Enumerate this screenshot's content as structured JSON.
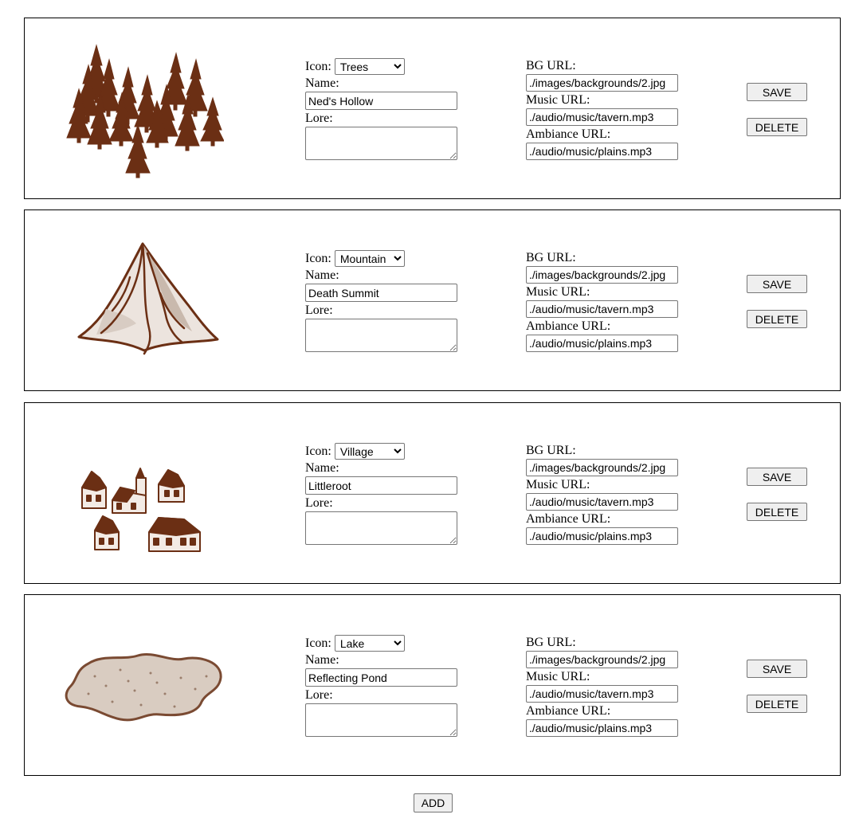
{
  "labels": {
    "icon": "Icon:",
    "name": "Name:",
    "lore": "Lore:",
    "bg_url": "BG URL:",
    "music_url": "Music URL:",
    "ambiance_url": "Ambiance URL:",
    "save": "SAVE",
    "delete": "DELETE",
    "add": "ADD"
  },
  "colors": {
    "ink": "#6b2f14",
    "mountain_shade": "#c9b9ad",
    "lake_fill": "#d9ccc1",
    "lake_border": "#7a4a32"
  },
  "locations": [
    {
      "icon_name": "trees-icon",
      "icon": "Trees",
      "name": "Ned's Hollow",
      "lore": "",
      "bg_url": "./images/backgrounds/2.jpg",
      "music_url": "./audio/music/tavern.mp3",
      "ambiance_url": "./audio/music/plains.mp3"
    },
    {
      "icon_name": "mountain-icon",
      "icon": "Mountain",
      "name": "Death Summit",
      "lore": "",
      "bg_url": "./images/backgrounds/2.jpg",
      "music_url": "./audio/music/tavern.mp3",
      "ambiance_url": "./audio/music/plains.mp3"
    },
    {
      "icon_name": "village-icon",
      "icon": "Village",
      "name": "Littleroot",
      "lore": "",
      "bg_url": "./images/backgrounds/2.jpg",
      "music_url": "./audio/music/tavern.mp3",
      "ambiance_url": "./audio/music/plains.mp3"
    },
    {
      "icon_name": "lake-icon",
      "icon": "Lake",
      "name": "Reflecting Pond",
      "lore": "",
      "bg_url": "./images/backgrounds/2.jpg",
      "music_url": "./audio/music/tavern.mp3",
      "ambiance_url": "./audio/music/plains.mp3"
    }
  ]
}
